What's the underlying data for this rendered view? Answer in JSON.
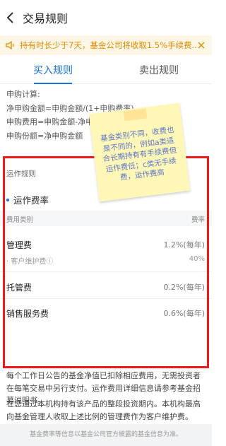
{
  "header": {
    "title": "交易规则"
  },
  "notice": {
    "text": "持有时长少于7天，基金公司将收取1.5%手续费..."
  },
  "tabs": [
    {
      "label": "买入规则",
      "active": true
    },
    {
      "label": "卖出规则",
      "active": false
    }
  ],
  "formula": {
    "heading": "申购计算:",
    "lines": [
      "净申购金额=申购金额/(1+申购费率)",
      "申购费用=申购金额-净申购",
      "申购份额=净申购金额"
    ]
  },
  "panel": {
    "section_title": "运作规则",
    "sub_title": "运作费率",
    "table_header": {
      "col1": "费用类别",
      "col2": "费率"
    },
    "rows": [
      {
        "name": "管理费",
        "value": "1.2%(每年)",
        "sub_name": "· 客户维护费ⓘ",
        "sub_value": "40%"
      },
      {
        "name": "托管费",
        "value": "0.2%(每年)"
      },
      {
        "name": "销售服务费",
        "value": "0.6%(每年)"
      }
    ]
  },
  "sticky_note": {
    "text": "基金类别不同，收费也是不同的，例如a类适合长期持有有手续费但运作费低；c类无手续费，运作费高"
  },
  "description": {
    "p1": "每个工作日公告的基金净值已扣除相应费用，无需投资者在每笔交易中另行支付。运作费用详细信息请参考基金招募说明书。",
    "p2": "在您通过本机构持有该产品的整段投资期内。本机构最高向基金管理人收取上述比例的管理费作为客户维护费。"
  },
  "footer": {
    "text": "基金费率等信息以基金公司官方披露的基金信息为准。"
  },
  "colors": {
    "accent": "#1a73d9",
    "warning": "#e08a00",
    "highlight_box": "#f01a1a",
    "note_bg": "#fff7b8"
  }
}
